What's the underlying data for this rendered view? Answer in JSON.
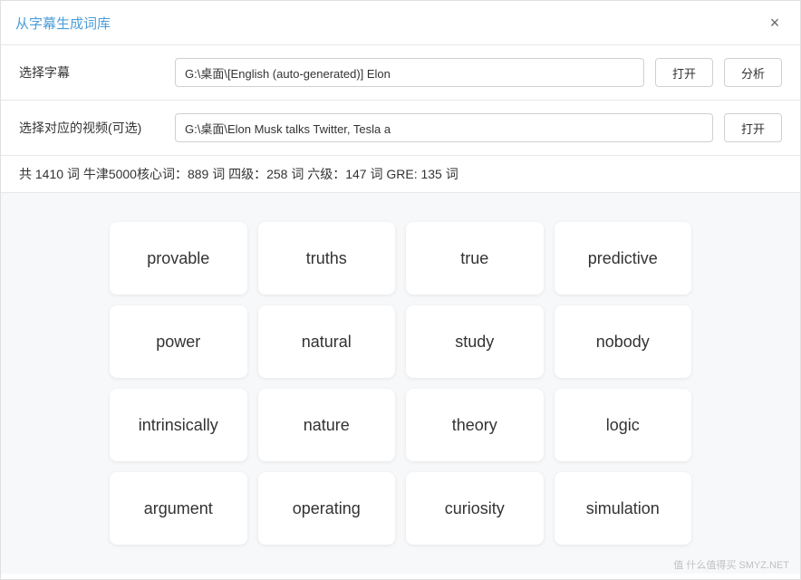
{
  "window": {
    "title": "从字幕生成词库",
    "close_icon": "×"
  },
  "form": {
    "subtitle_label": "选择字幕",
    "subtitle_value": "G:\\桌面\\[English (auto-generated)] Elon",
    "open_btn1": "打开",
    "analyze_btn": "分析",
    "video_label": "选择对应的视频(可选)",
    "video_value": "G:\\桌面\\Elon Musk talks Twitter, Tesla a",
    "open_btn2": "打开"
  },
  "stats": {
    "text": "共 1410 词  牛津5000核心词：889 词  四级：258 词  六级：147 词  GRE: 135 词"
  },
  "words": [
    {
      "word": "provable"
    },
    {
      "word": "truths"
    },
    {
      "word": "true"
    },
    {
      "word": "predictive"
    },
    {
      "word": "power"
    },
    {
      "word": "natural"
    },
    {
      "word": "study"
    },
    {
      "word": "nobody"
    },
    {
      "word": "intrinsically"
    },
    {
      "word": "nature"
    },
    {
      "word": "theory"
    },
    {
      "word": "logic"
    },
    {
      "word": "argument"
    },
    {
      "word": "operating"
    },
    {
      "word": "curiosity"
    },
    {
      "word": "simulation"
    }
  ],
  "watermark": "值 什么值得买 SMYZ.NET"
}
